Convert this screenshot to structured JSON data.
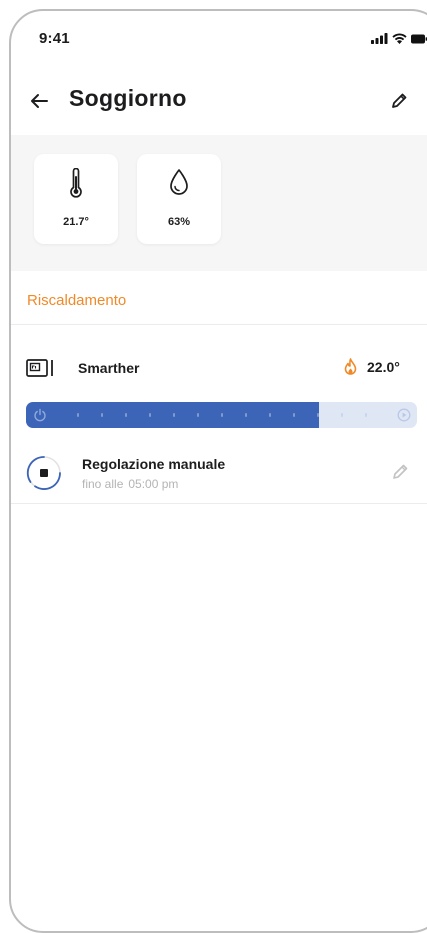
{
  "status_bar": {
    "time": "9:41"
  },
  "header": {
    "title": "Soggiorno",
    "back_icon": "arrow-left-icon",
    "edit_icon": "pencil-icon"
  },
  "sensors": [
    {
      "icon": "thermometer-icon",
      "value": "21.7°"
    },
    {
      "icon": "humidity-drop-icon",
      "value": "63%"
    }
  ],
  "section": {
    "title": "Riscaldamento"
  },
  "device": {
    "icon": "thermostat-icon",
    "name": "Smarther",
    "setpoint_icon": "flame-icon",
    "setpoint": "22.0°"
  },
  "timeline": {
    "progress_fraction": 0.75,
    "start_icon": "power-icon",
    "end_icon": "play-icon"
  },
  "mode": {
    "icon": "stop-icon",
    "title": "Regolazione manuale",
    "until_label": "fino alle",
    "until_time": "05:00 pm",
    "edit_icon": "pencil-icon"
  },
  "colors": {
    "accent": "#f08a28",
    "timeline_fill": "#3c64b7",
    "timeline_track": "#dfe7f5"
  }
}
